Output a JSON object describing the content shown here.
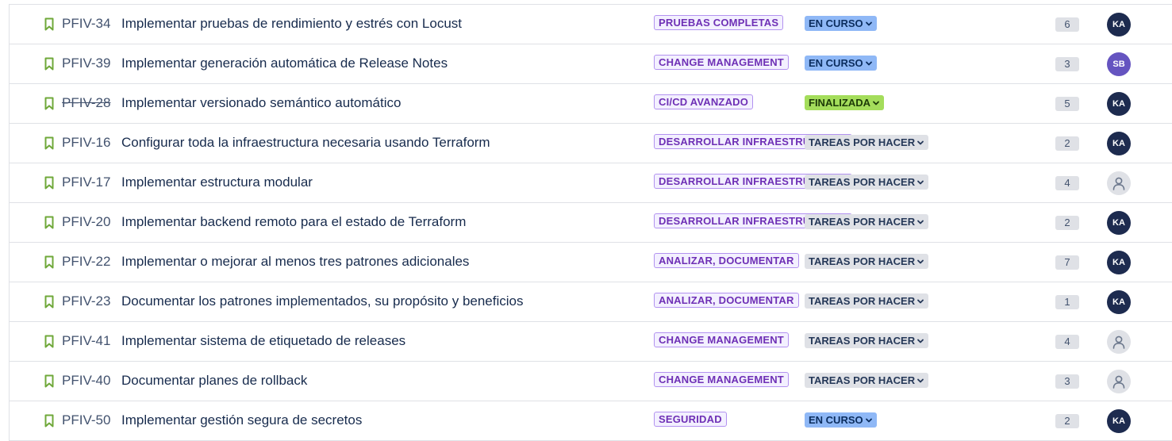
{
  "colors": {
    "bookmark": "#6fa83a",
    "epic_border": "#b392f0",
    "status_inprogress": "#8fb8f6",
    "status_done": "#a4dd5b",
    "status_todo": "#dfe1e6",
    "avatar_ka": "#1d2b4f",
    "avatar_sb": "#6554c0"
  },
  "issues": [
    {
      "key": "PFIV-34",
      "summary": "Implementar pruebas de rendimiento y estrés con Locust",
      "epic": "PRUEBAS COMPLETAS",
      "status": "EN CURSO",
      "status_type": "inprogress",
      "points": "6",
      "assignee": "KA",
      "assignee_color": "#1d2b4f",
      "done": false,
      "icon": "bookmark-icon"
    },
    {
      "key": "PFIV-39",
      "summary": "Implementar generación automática de Release Notes",
      "epic": "CHANGE MANAGEMENT",
      "status": "EN CURSO",
      "status_type": "inprogress",
      "points": "3",
      "assignee": "SB",
      "assignee_color": "#6554c0",
      "done": false,
      "icon": "bookmark-icon"
    },
    {
      "key": "PFIV-28",
      "summary": "Implementar versionado semántico automático",
      "epic": "CI/CD AVANZADO",
      "status": "FINALIZADA",
      "status_type": "done",
      "points": "5",
      "assignee": "KA",
      "assignee_color": "#1d2b4f",
      "done": true,
      "icon": "bookmark-icon"
    },
    {
      "key": "PFIV-16",
      "summary": "Configurar toda la infraestructura necesaria usando Terraform",
      "epic": "DESARROLLAR INFRAESTRUCTURA",
      "status": "TAREAS POR HACER",
      "status_type": "todo",
      "points": "2",
      "assignee": "KA",
      "assignee_color": "#1d2b4f",
      "done": false,
      "icon": "bookmark-icon"
    },
    {
      "key": "PFIV-17",
      "summary": "Implementar estructura modular",
      "epic": "DESARROLLAR INFRAESTRUCTURA",
      "status": "TAREAS POR HACER",
      "status_type": "todo",
      "points": "4",
      "assignee": "",
      "assignee_color": "#dfe1e6",
      "done": false,
      "icon": "bookmark-icon"
    },
    {
      "key": "PFIV-20",
      "summary": "Implementar backend remoto para el estado de Terraform",
      "epic": "DESARROLLAR INFRAESTRUCTURA",
      "status": "TAREAS POR HACER",
      "status_type": "todo",
      "points": "2",
      "assignee": "KA",
      "assignee_color": "#1d2b4f",
      "done": false,
      "icon": "bookmark-icon"
    },
    {
      "key": "PFIV-22",
      "summary": "Implementar o mejorar al menos tres patrones adicionales",
      "epic": "ANALIZAR, DOCUMENTAR",
      "status": "TAREAS POR HACER",
      "status_type": "todo",
      "points": "7",
      "assignee": "KA",
      "assignee_color": "#1d2b4f",
      "done": false,
      "icon": "bookmark-icon"
    },
    {
      "key": "PFIV-23",
      "summary": "Documentar los patrones implementados, su propósito y beneficios",
      "epic": "ANALIZAR, DOCUMENTAR",
      "status": "TAREAS POR HACER",
      "status_type": "todo",
      "points": "1",
      "assignee": "KA",
      "assignee_color": "#1d2b4f",
      "done": false,
      "icon": "bookmark-icon"
    },
    {
      "key": "PFIV-41",
      "summary": "Implementar sistema de etiquetado de releases",
      "epic": "CHANGE MANAGEMENT",
      "status": "TAREAS POR HACER",
      "status_type": "todo",
      "points": "4",
      "assignee": "",
      "assignee_color": "#dfe1e6",
      "done": false,
      "icon": "bookmark-icon"
    },
    {
      "key": "PFIV-40",
      "summary": "Documentar planes de rollback",
      "epic": "CHANGE MANAGEMENT",
      "status": "TAREAS POR HACER",
      "status_type": "todo",
      "points": "3",
      "assignee": "",
      "assignee_color": "#dfe1e6",
      "done": false,
      "icon": "bookmark-icon"
    },
    {
      "key": "PFIV-50",
      "summary": "Implementar gestión segura de secretos",
      "epic": "SEGURIDAD",
      "status": "EN CURSO",
      "status_type": "inprogress",
      "points": "2",
      "assignee": "KA",
      "assignee_color": "#1d2b4f",
      "done": false,
      "icon": "bookmark-icon"
    }
  ]
}
